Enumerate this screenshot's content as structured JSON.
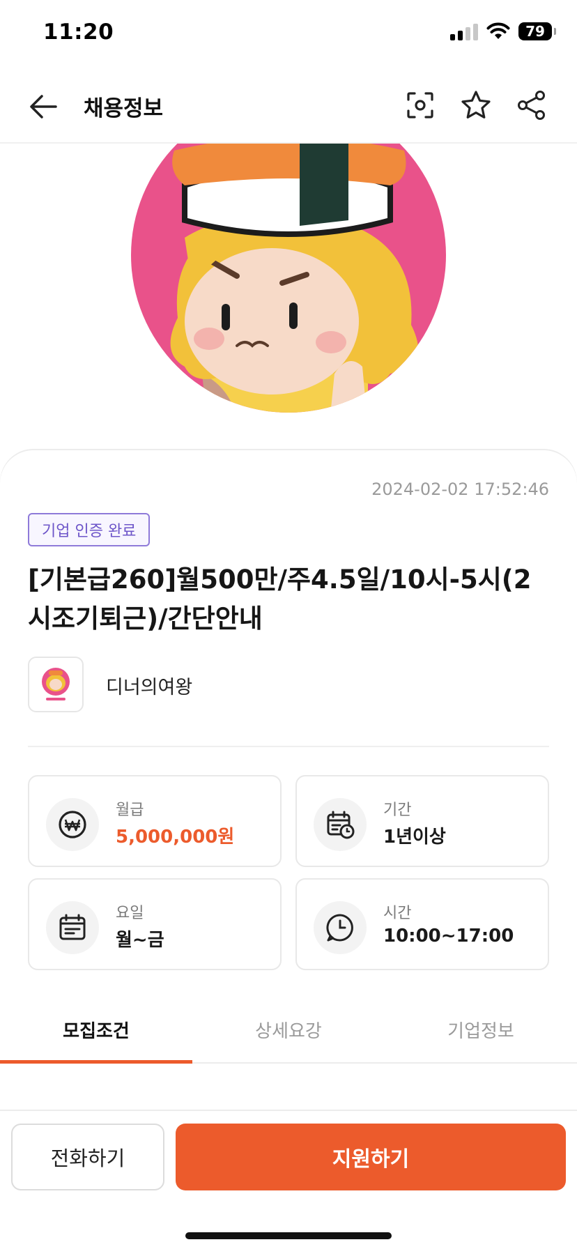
{
  "status_bar": {
    "time": "11:20",
    "battery": "79"
  },
  "nav": {
    "title": "채용정보"
  },
  "job": {
    "posted_at": "2024-02-02 17:52:46",
    "badge": "기업 인증 완료",
    "title": "[기본급260]월500만/주4.5일/10시-5시(2시조기퇴근)/간단안내",
    "company_name": "디너의여왕"
  },
  "info": {
    "salary": {
      "label": "월급",
      "value": "5,000,000원"
    },
    "period": {
      "label": "기간",
      "value": "1년이상"
    },
    "days": {
      "label": "요일",
      "value": "월~금"
    },
    "hours": {
      "label": "시간",
      "value": "10:00~17:00"
    }
  },
  "tabs": [
    {
      "label": "모집조건",
      "active": true
    },
    {
      "label": "상세요강",
      "active": false
    },
    {
      "label": "기업정보",
      "active": false
    }
  ],
  "actions": {
    "call_label": "전화하기",
    "apply_label": "지원하기"
  },
  "colors": {
    "accent": "#ec5b2c",
    "badge": "#6d55c9"
  },
  "icons": {
    "back": "arrow-left-icon",
    "scan": "scan-icon",
    "star": "star-icon",
    "share": "share-icon",
    "salary": "won-icon",
    "period": "calendar-clock-icon",
    "days": "calendar-icon",
    "hours": "clock-icon"
  }
}
